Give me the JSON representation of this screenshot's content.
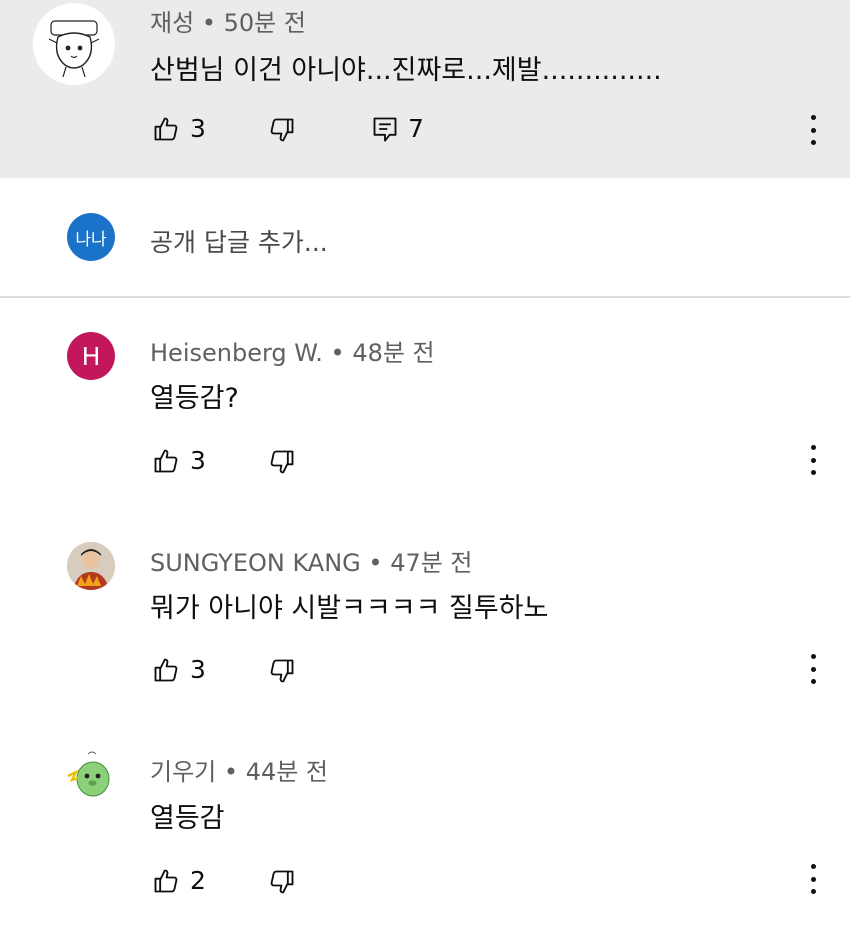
{
  "top_comment": {
    "author": "재성",
    "time": "50분 전",
    "text": "산범님 이건 아니야...진짜로...제발..............",
    "likes": "3",
    "replies": "7"
  },
  "reply_box": {
    "avatar_text": "나나",
    "placeholder": "공개 답글 추가..."
  },
  "comments": [
    {
      "author": "Heisenberg W.",
      "time": "48분 전",
      "text": "열등감?",
      "likes": "3",
      "avatar_letter": "H"
    },
    {
      "author": "SUNGYEON KANG",
      "time": "47분 전",
      "text": "뭐가 아니야 시발ㅋㅋㅋㅋ 질투하노",
      "likes": "3"
    },
    {
      "author": "기우기",
      "time": "44분 전",
      "text": "열등감",
      "likes": "2"
    }
  ],
  "separator": "•",
  "colors": {
    "highlight_bg": "#ebebeb",
    "reply_avatar": "#1a73c9",
    "h_avatar": "#c2185b"
  }
}
